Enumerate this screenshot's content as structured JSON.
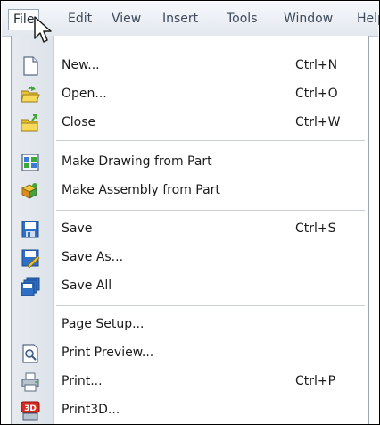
{
  "menubar": {
    "items": [
      {
        "label": "File"
      },
      {
        "label": "Edit"
      },
      {
        "label": "View"
      },
      {
        "label": "Insert"
      },
      {
        "label": "Tools"
      },
      {
        "label": "Window"
      },
      {
        "label": "Help"
      }
    ]
  },
  "file_menu": {
    "items": [
      {
        "label": "New...",
        "shortcut": "Ctrl+N",
        "icon": "new-document-icon"
      },
      {
        "label": "Open...",
        "shortcut": "Ctrl+O",
        "icon": "open-folder-icon"
      },
      {
        "label": "Close",
        "shortcut": "Ctrl+W",
        "icon": "close-folder-icon"
      },
      {
        "label": "Make Drawing from Part",
        "shortcut": "",
        "icon": "make-drawing-icon"
      },
      {
        "label": "Make Assembly from Part",
        "shortcut": "",
        "icon": "make-assembly-icon"
      },
      {
        "label": "Save",
        "shortcut": "Ctrl+S",
        "icon": "save-icon"
      },
      {
        "label": "Save As...",
        "shortcut": "",
        "icon": "save-as-icon"
      },
      {
        "label": "Save All",
        "shortcut": "",
        "icon": "save-all-icon"
      },
      {
        "label": "Page Setup...",
        "shortcut": "",
        "icon": ""
      },
      {
        "label": "Print Preview...",
        "shortcut": "",
        "icon": "print-preview-icon"
      },
      {
        "label": "Print...",
        "shortcut": "Ctrl+P",
        "icon": "print-icon"
      },
      {
        "label": "Print3D...",
        "shortcut": "",
        "icon": "print3d-icon"
      }
    ]
  },
  "colors": {
    "menubar_bg": "#e3e8ef",
    "gutter_bg": "#e1e6ec",
    "separator": "#c8cfd8",
    "text": "#1c1c1c"
  }
}
